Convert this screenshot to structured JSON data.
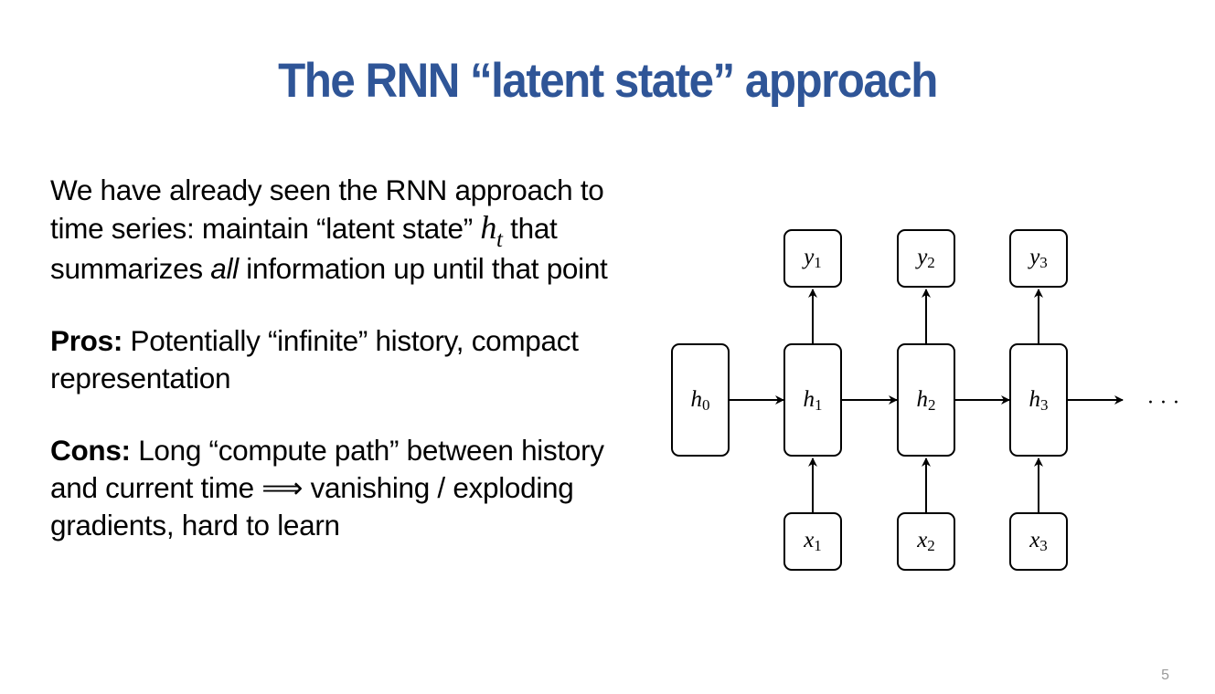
{
  "slide": {
    "title": "The RNN “latent state” approach",
    "page_number": "5"
  },
  "text": {
    "intro_before_math": "We have already seen the RNN approach to time series: maintain “latent state” ",
    "intro_math_var": "h",
    "intro_math_sub": "t",
    "intro_line3_before_em": " that summarizes ",
    "intro_em": "all",
    "intro_after_em": " information up until that point",
    "pros_label": "Pros:",
    "pros_text": " Potentially “infinite” history, compact representation",
    "cons_label": "Cons:",
    "cons_text_before_arrow": " Long “compute path” between history and current time ",
    "cons_arrow": "⟹",
    "cons_text_after_arrow": " vanishing / exploding gradients, hard to learn"
  },
  "diagram": {
    "initial_state": {
      "var": "h",
      "sub": "0"
    },
    "steps": [
      {
        "h": {
          "var": "h",
          "sub": "1"
        },
        "x": {
          "var": "x",
          "sub": "1"
        },
        "y": {
          "var": "y",
          "sub": "1"
        }
      },
      {
        "h": {
          "var": "h",
          "sub": "2"
        },
        "x": {
          "var": "x",
          "sub": "2"
        },
        "y": {
          "var": "y",
          "sub": "2"
        }
      },
      {
        "h": {
          "var": "h",
          "sub": "3"
        },
        "x": {
          "var": "x",
          "sub": "3"
        },
        "y": {
          "var": "y",
          "sub": "3"
        }
      }
    ],
    "continuation": "· · ·"
  },
  "colors": {
    "title": "#2f5597",
    "text": "#000000",
    "page_number": "#9a9a9a"
  }
}
